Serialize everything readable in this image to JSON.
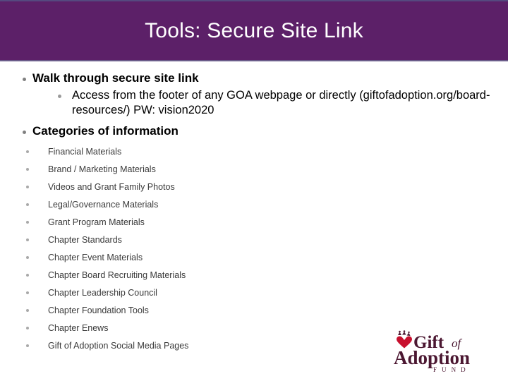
{
  "slide": {
    "title": "Tools: Secure Site Link",
    "banner_color": "#5C2068",
    "title_color": "#FFFFFF",
    "background_color": "#FFFFFF"
  },
  "outline": {
    "items": [
      {
        "level": 1,
        "text": "Walk through secure site link",
        "children": [
          {
            "level": 2,
            "text": "Access from the footer of any GOA webpage or directly (giftofadoption.org/board-resources/) PW: vision2020"
          }
        ]
      },
      {
        "level": 1,
        "text": "Categories of information",
        "children": []
      }
    ],
    "categories": [
      "Financial Materials",
      "Brand / Marketing Materials",
      "Videos and Grant Family Photos",
      "Legal/Governance Materials",
      "Grant Program Materials",
      "Chapter Standards",
      "Chapter Event Materials",
      "Chapter Board Recruiting Materials",
      "Chapter Leadership Council",
      "Chapter Foundation Tools",
      "Chapter Enews",
      "Gift of Adoption Social Media Pages"
    ]
  },
  "logo": {
    "line1": "Gift",
    "line1b": "of",
    "line2": "Adoption",
    "line3": "F  U  N  D",
    "heart_color": "#C8102E",
    "text_color": "#4B1731"
  }
}
